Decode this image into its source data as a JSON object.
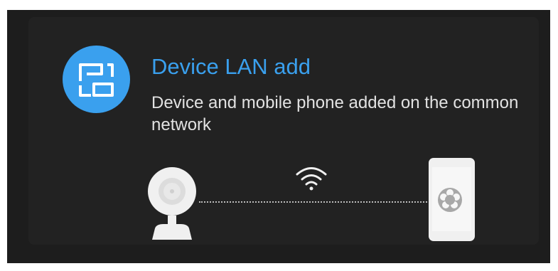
{
  "option": {
    "title": "Device LAN add",
    "description": "Device and mobile phone added on the common network"
  },
  "icons": {
    "option_icon": "device-lan-add-icon",
    "camera": "camera-icon",
    "wifi": "wifi-icon",
    "phone": "phone-icon",
    "connection": "dotted-connection-line"
  },
  "colors": {
    "background": "#1d1d1d",
    "card": "#222222",
    "accent": "#3aa0ee",
    "text": "#e2e2e2",
    "illustration": "#f0f0f0"
  }
}
